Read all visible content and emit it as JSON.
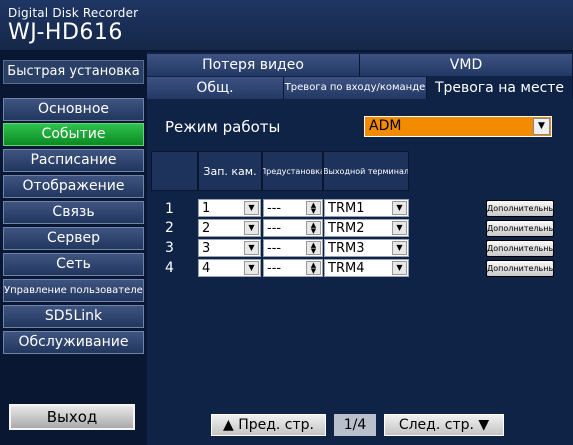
{
  "app": {
    "line1": "Digital Disk Recorder",
    "line2": "WJ-HD616"
  },
  "sidebar": {
    "quick_setup": "Быстрая установка",
    "items": [
      {
        "label": "Основное",
        "active": false
      },
      {
        "label": "Событие",
        "active": true
      },
      {
        "label": "Расписание",
        "active": false
      },
      {
        "label": "Отображение",
        "active": false
      },
      {
        "label": "Связь",
        "active": false
      },
      {
        "label": "Сервер",
        "active": false
      },
      {
        "label": "Сеть",
        "active": false
      },
      {
        "label": "Управление пользователем",
        "active": false
      },
      {
        "label": "SD5Link",
        "active": false
      },
      {
        "label": "Обслуживание",
        "active": false
      }
    ],
    "exit": "Выход"
  },
  "tabs": {
    "row1": [
      "Потеря видео",
      "VMD"
    ],
    "row2": [
      "Общ.",
      "Тревога по входу/команде",
      "Тревога на месте"
    ],
    "active": "Тревога на месте"
  },
  "mode": {
    "label": "Режим работы",
    "value": "ADM"
  },
  "table": {
    "headers": [
      "Зап. кам.",
      "Предустановка",
      "Выходной терминал"
    ],
    "rows": [
      {
        "num": "1",
        "camera": "1",
        "preset": "---",
        "terminal": "TRM1",
        "advanced": "Дополнительные"
      },
      {
        "num": "2",
        "camera": "2",
        "preset": "---",
        "terminal": "TRM2",
        "advanced": "Дополнительные"
      },
      {
        "num": "3",
        "camera": "3",
        "preset": "---",
        "terminal": "TRM3",
        "advanced": "Дополнительные"
      },
      {
        "num": "4",
        "camera": "4",
        "preset": "---",
        "terminal": "TRM4",
        "advanced": "Дополнительные"
      }
    ]
  },
  "pager": {
    "prev": "▲ Пред. стр.",
    "page": "1/4",
    "next": "След. стр. ▼"
  }
}
